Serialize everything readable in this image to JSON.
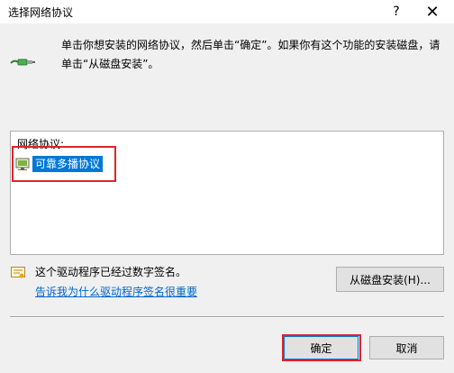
{
  "window": {
    "title": "选择网络协议",
    "help_glyph": "?",
    "close_glyph": "✕"
  },
  "instructions": {
    "line1": "单击你想安装的网络协议，然后单击“确定”。如果你有这个功能的安装磁盘，请",
    "line2": "单击“从磁盘安装”。"
  },
  "protocol_list": {
    "label": "网络协议:",
    "items": [
      {
        "label": "可靠多播协议",
        "selected": true
      }
    ]
  },
  "signature": {
    "status_text": "这个驱动程序已经过数字签名。",
    "link_text": "告诉我为什么驱动程序签名很重要"
  },
  "buttons": {
    "have_disk": "从磁盘安装(H)...",
    "ok": "确定",
    "cancel": "取消"
  },
  "colors": {
    "selection": "#0078d7",
    "link": "#0066cc",
    "highlight_annotation": "#e0222a"
  }
}
